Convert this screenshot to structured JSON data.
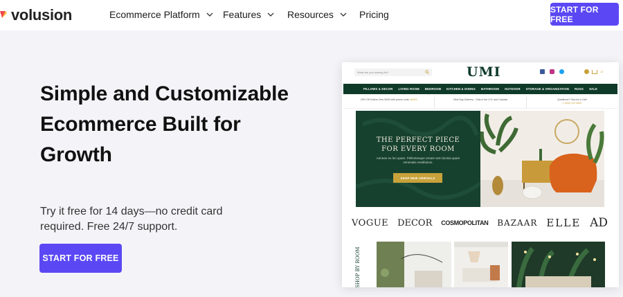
{
  "nav": {
    "brand": "volusion",
    "items": [
      {
        "label": "Ecommerce Platform",
        "has_dropdown": true
      },
      {
        "label": "Features",
        "has_dropdown": true
      },
      {
        "label": "Resources",
        "has_dropdown": true
      },
      {
        "label": "Pricing",
        "has_dropdown": false
      }
    ],
    "cta": "START FOR FREE"
  },
  "hero": {
    "title": "Simple and Customizable Ecommerce Built for Growth",
    "subtitle": "Try it free for 14 days—no credit card required. Free 24/7 support.",
    "cta": "START FOR FREE"
  },
  "mockup": {
    "search_placeholder": "What are you looking for?",
    "brand": "UMI",
    "cart_count": "12",
    "categories": [
      "PILLOWS & DECOR",
      "LIVING ROOM",
      "BEDROOM",
      "KITCHEN & DINING",
      "BATHROOM",
      "OUTDOOR",
      "STORAGE & ORGANIZATION",
      "RUGS",
      "SALE"
    ],
    "promos": [
      {
        "text": "25% Off Orders Over $100 with promo code",
        "code": "UMI25"
      },
      {
        "text": "Next Day Delivery - Only in the U.S. and Canada",
        "code": ""
      },
      {
        "text": "Questions? Give As a Call!",
        "code": "1 (800) 123 4849"
      }
    ],
    "banner": {
      "title_line1": "THE PERFECT PIECE",
      "title_line2": "FOR EVERY ROOM",
      "text": "Aenean eu leo quam. Pellentesque ornare sem lacinia quam venenatis vestibulum.",
      "button": "SHOP NEW ARRIVALS"
    },
    "press": [
      "VOGUE",
      "DECOR",
      "COSMOPOLITAN",
      "BAZAAR",
      "ELLE",
      "AD"
    ],
    "shop_label": "SHOP BY ROOM"
  },
  "colors": {
    "accent": "#5b48f4",
    "umi_green": "#0f3a2a",
    "umi_gold": "#c8a23a"
  }
}
